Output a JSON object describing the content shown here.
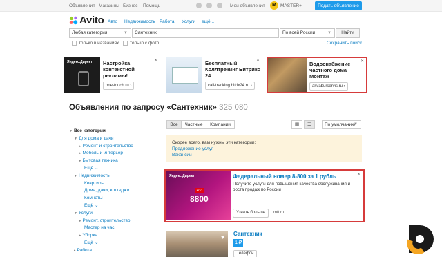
{
  "topbar": {
    "links": [
      "Объявления",
      "Магазины",
      "Бизнес",
      "Помощь"
    ],
    "my_ads": "Мои объявления",
    "user": "MASTER+",
    "post_button": "Подать объявление"
  },
  "header": {
    "logo": "Avito",
    "nav": [
      "Авто",
      "Недвижимость",
      "Работа",
      "Услуги",
      "ещё..."
    ]
  },
  "search": {
    "category": "Любая категория",
    "query": "Сантехник",
    "region": "По всей России",
    "button": "Найти",
    "only_titles": "только в названиях",
    "only_photo": "только с фото",
    "save": "Сохранить поиск"
  },
  "ads": [
    {
      "brand": "Яндекс.Директ",
      "title": "Настройка контекстной рекламы!",
      "link": "one-touch.ru ›"
    },
    {
      "brand": "",
      "title": "Бесплатный Коллтрекинг Битрикс 24",
      "link": "call-tracking.bitrix24.ru ›"
    },
    {
      "brand": "",
      "title": "Водоснабжение частного дома Монтаж",
      "link": "akvaburservis.ru ›"
    }
  ],
  "page": {
    "title": "Объявления по запросу «Сантехник»",
    "count": "325 080"
  },
  "sidebar": {
    "root": "Все категории",
    "items": [
      {
        "label": "Для дома и дачи",
        "level": 1,
        "tri": true
      },
      {
        "label": "Ремонт и строительство",
        "level": 2,
        "tri": true
      },
      {
        "label": "Мебель и интерьер",
        "level": 2,
        "tri": true
      },
      {
        "label": "Бытовая техника",
        "level": 2,
        "tri": true
      },
      {
        "label": "Ещё ⌄",
        "level": 3,
        "tri": false
      },
      {
        "label": "Недвижимость",
        "level": 1,
        "tri": true
      },
      {
        "label": "Квартиры",
        "level": 3,
        "tri": false
      },
      {
        "label": "Дома, дачи, коттеджи",
        "level": 3,
        "tri": false
      },
      {
        "label": "Комнаты",
        "level": 3,
        "tri": false
      },
      {
        "label": "Ещё ⌄",
        "level": 3,
        "tri": false
      },
      {
        "label": "Услуги",
        "level": 1,
        "tri": true
      },
      {
        "label": "Ремонт, строительство",
        "level": 2,
        "tri": true
      },
      {
        "label": "Мастер на час",
        "level": 3,
        "tri": false
      },
      {
        "label": "Уборка",
        "level": 2,
        "tri": true
      },
      {
        "label": "Ещё ⌄",
        "level": 3,
        "tri": false
      },
      {
        "label": "Работа",
        "level": 1,
        "tri": true
      }
    ]
  },
  "filters": {
    "segments": [
      "Все",
      "Частные",
      "Компании"
    ],
    "sort": "По умолчанию"
  },
  "suggestion": {
    "text": "Скорее всего, вам нужны эти категории:",
    "links": [
      "Предложение услуг",
      "Вакансии"
    ]
  },
  "promo": {
    "brand": "Яндекс.Директ",
    "badge": "МТС",
    "number": "8800",
    "title": "Федеральный номер 8-800 за 1 рубль",
    "desc": "Получите услуги для повышения качества обслуживания и роста продаж по России",
    "button": "Узнать больше",
    "domain": "mtt.ru"
  },
  "listing": {
    "title": "Сантехник",
    "price": "1 ₽",
    "phone": "Телефон"
  }
}
